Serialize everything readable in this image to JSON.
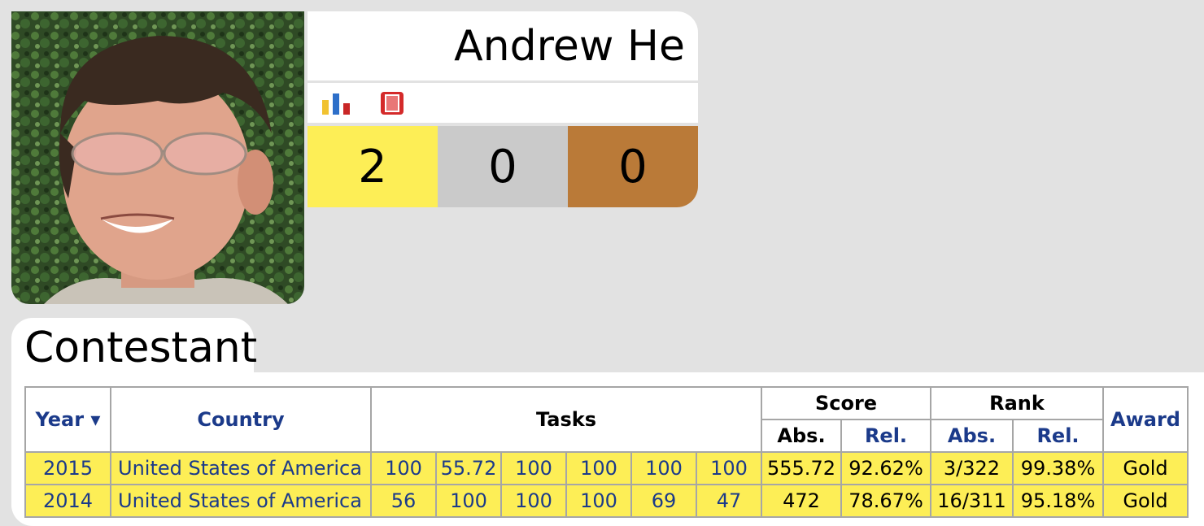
{
  "profile": {
    "name": "Andrew He",
    "icons": [
      "bar-chart-icon",
      "book-icon"
    ],
    "medals": {
      "gold": "2",
      "silver": "0",
      "bronze": "0"
    }
  },
  "section": {
    "title": "Contestant"
  },
  "table": {
    "headers": {
      "year": "Year ▾",
      "country": "Country",
      "tasks": "Tasks",
      "score": "Score",
      "rank": "Rank",
      "award": "Award",
      "score_abs": "Abs.",
      "score_rel": "Rel.",
      "rank_abs": "Abs.",
      "rank_rel": "Rel."
    },
    "rows": [
      {
        "year": "2015",
        "country": "United States of America",
        "tasks": [
          "100",
          "55.72",
          "100",
          "100",
          "100",
          "100"
        ],
        "score_abs": "555.72",
        "score_rel": "92.62%",
        "rank_abs": "3/322",
        "rank_rel": "99.38%",
        "award": "Gold"
      },
      {
        "year": "2014",
        "country": "United States of America",
        "tasks": [
          "56",
          "100",
          "100",
          "100",
          "69",
          "47"
        ],
        "score_abs": "472",
        "score_rel": "78.67%",
        "rank_abs": "16/311",
        "rank_rel": "95.18%",
        "award": "Gold"
      }
    ]
  },
  "colors": {
    "gold": "#fdee56",
    "silver": "#cacaca",
    "bronze": "#ba7a38",
    "link": "#1b3a8a"
  }
}
